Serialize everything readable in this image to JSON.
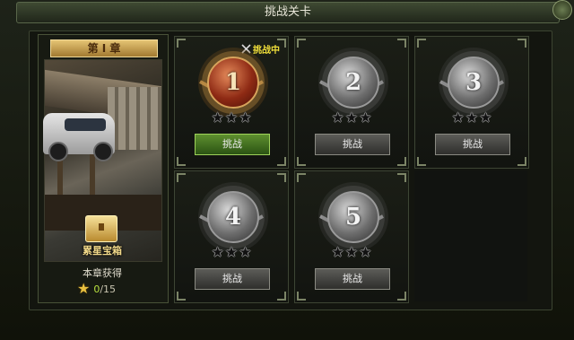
{
  "window": {
    "title": "挑战关卡"
  },
  "chapter": {
    "title": "第 I 章",
    "chest_label": "累星宝箱",
    "obtained_label": "本章获得",
    "stars_current": "0",
    "stars_total": "/15"
  },
  "levels": [
    {
      "number": "1",
      "button_label": "挑战",
      "status": "挑战中",
      "stars": [
        "★",
        "★",
        "★"
      ]
    },
    {
      "number": "2",
      "button_label": "挑战",
      "stars": [
        "★",
        "★",
        "★"
      ]
    },
    {
      "number": "3",
      "button_label": "挑战",
      "stars": [
        "★",
        "★",
        "★"
      ]
    },
    {
      "number": "4",
      "button_label": "挑战",
      "stars": [
        "★",
        "★",
        "★"
      ]
    },
    {
      "number": "5",
      "button_label": "挑战",
      "stars": [
        "★",
        "★",
        "★"
      ]
    }
  ],
  "icons": {
    "close": "close-icon",
    "chest": "treasure-chest-icon",
    "star": "star-icon",
    "crossed_swords": "crossed-swords-icon"
  },
  "colors": {
    "active_button": "#4a7a24",
    "inactive_button": "#3e3e3a",
    "status_text": "#f1df3a",
    "gold": "#e8c040"
  }
}
